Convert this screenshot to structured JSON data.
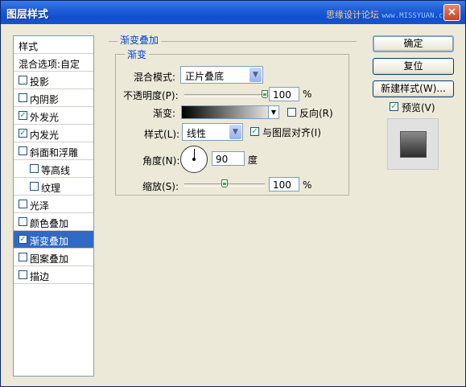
{
  "window": {
    "title": "图层样式",
    "close_symbol": "×"
  },
  "watermark": {
    "text": "思缘设计论坛",
    "site": "www.MISSYUAN.com"
  },
  "sidebar": {
    "items": [
      {
        "label": "样式",
        "kind": "header"
      },
      {
        "label": "混合选项:自定",
        "kind": "header"
      },
      {
        "label": "投影",
        "checked": false
      },
      {
        "label": "内阴影",
        "checked": false
      },
      {
        "label": "外发光",
        "checked": true
      },
      {
        "label": "内发光",
        "checked": true
      },
      {
        "label": "斜面和浮雕",
        "checked": false
      },
      {
        "label": "等高线",
        "checked": false,
        "indent": true
      },
      {
        "label": "纹理",
        "checked": false,
        "indent": true
      },
      {
        "label": "光泽",
        "checked": false
      },
      {
        "label": "颜色叠加",
        "checked": false
      },
      {
        "label": "渐变叠加",
        "checked": true,
        "selected": true
      },
      {
        "label": "图案叠加",
        "checked": false
      },
      {
        "label": "描边",
        "checked": false
      }
    ]
  },
  "panel": {
    "section_title": "渐变叠加",
    "group_title": "渐变",
    "blend_mode": {
      "label": "混合模式:",
      "value": "正片叠底"
    },
    "opacity": {
      "label": "不透明度(P):",
      "value": "100",
      "unit": "%",
      "level": 1.0
    },
    "gradient": {
      "label": "渐变:",
      "from": "#000000",
      "to": "#ffffff",
      "reverse_label": "反向(R)",
      "reverse": false
    },
    "style": {
      "label": "样式(L):",
      "value": "线性",
      "align_label": "与图层对齐(I)",
      "align": true
    },
    "angle": {
      "label": "角度(N):",
      "value": "90",
      "unit": "度"
    },
    "scale": {
      "label": "缩放(S):",
      "value": "100",
      "unit": "%",
      "level": 0.5
    }
  },
  "buttons": {
    "ok": "确定",
    "reset": "复位",
    "new_style": "新建样式(W)...",
    "preview_label": "预览(V)",
    "preview": true
  },
  "colors": {
    "title_bar": "#2360d9",
    "selection": "#316ac5",
    "legend": "#0046d5",
    "check": "#21a121"
  }
}
